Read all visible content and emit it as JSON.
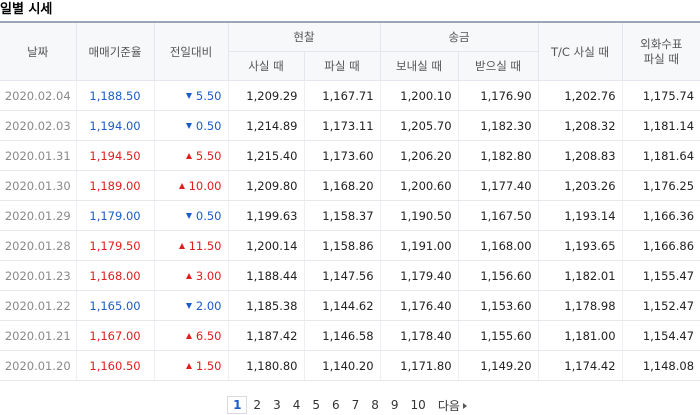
{
  "section_title": "일별 시세",
  "headers": {
    "date": "날짜",
    "base_rate": "매매기준율",
    "change": "전일대비",
    "cash": "현찰",
    "cash_buy": "사실 때",
    "cash_sell": "파실 때",
    "transfer": "송금",
    "transfer_send": "보내실 때",
    "transfer_receive": "받으실 때",
    "tc_buy": "T/C 사실 때",
    "foreign_check": "외화수표 파실 때"
  },
  "rows": [
    {
      "date": "2020.02.04",
      "base": "1,188.50",
      "dir": "down",
      "change": "5.50",
      "cash_buy": "1,209.29",
      "cash_sell": "1,167.71",
      "send": "1,200.10",
      "receive": "1,176.90",
      "tc": "1,202.76",
      "check": "1,175.74"
    },
    {
      "date": "2020.02.03",
      "base": "1,194.00",
      "dir": "down",
      "change": "0.50",
      "cash_buy": "1,214.89",
      "cash_sell": "1,173.11",
      "send": "1,205.70",
      "receive": "1,182.30",
      "tc": "1,208.32",
      "check": "1,181.14"
    },
    {
      "date": "2020.01.31",
      "base": "1,194.50",
      "dir": "up",
      "change": "5.50",
      "cash_buy": "1,215.40",
      "cash_sell": "1,173.60",
      "send": "1,206.20",
      "receive": "1,182.80",
      "tc": "1,208.83",
      "check": "1,181.64"
    },
    {
      "date": "2020.01.30",
      "base": "1,189.00",
      "dir": "up",
      "change": "10.00",
      "cash_buy": "1,209.80",
      "cash_sell": "1,168.20",
      "send": "1,200.60",
      "receive": "1,177.40",
      "tc": "1,203.26",
      "check": "1,176.25"
    },
    {
      "date": "2020.01.29",
      "base": "1,179.00",
      "dir": "down",
      "change": "0.50",
      "cash_buy": "1,199.63",
      "cash_sell": "1,158.37",
      "send": "1,190.50",
      "receive": "1,167.50",
      "tc": "1,193.14",
      "check": "1,166.36"
    },
    {
      "date": "2020.01.28",
      "base": "1,179.50",
      "dir": "up",
      "change": "11.50",
      "cash_buy": "1,200.14",
      "cash_sell": "1,158.86",
      "send": "1,191.00",
      "receive": "1,168.00",
      "tc": "1,193.65",
      "check": "1,166.86"
    },
    {
      "date": "2020.01.23",
      "base": "1,168.00",
      "dir": "up",
      "change": "3.00",
      "cash_buy": "1,188.44",
      "cash_sell": "1,147.56",
      "send": "1,179.40",
      "receive": "1,156.60",
      "tc": "1,182.01",
      "check": "1,155.47"
    },
    {
      "date": "2020.01.22",
      "base": "1,165.00",
      "dir": "down",
      "change": "2.00",
      "cash_buy": "1,185.38",
      "cash_sell": "1,144.62",
      "send": "1,176.40",
      "receive": "1,153.60",
      "tc": "1,178.98",
      "check": "1,152.47"
    },
    {
      "date": "2020.01.21",
      "base": "1,167.00",
      "dir": "up",
      "change": "6.50",
      "cash_buy": "1,187.42",
      "cash_sell": "1,146.58",
      "send": "1,178.40",
      "receive": "1,155.60",
      "tc": "1,181.00",
      "check": "1,154.47"
    },
    {
      "date": "2020.01.20",
      "base": "1,160.50",
      "dir": "up",
      "change": "1.50",
      "cash_buy": "1,180.80",
      "cash_sell": "1,140.20",
      "send": "1,171.80",
      "receive": "1,149.20",
      "tc": "1,174.42",
      "check": "1,148.08"
    }
  ],
  "pagination": {
    "pages": [
      "1",
      "2",
      "3",
      "4",
      "5",
      "6",
      "7",
      "8",
      "9",
      "10"
    ],
    "current": "1",
    "next_label": "다음"
  },
  "colors": {
    "up": "#e01e1e",
    "down": "#1c5cc8",
    "header_bg": "#f7f8fa",
    "header_border": "#9aa5b8"
  },
  "icons": {
    "up": "triangle-up-icon",
    "down": "triangle-down-icon",
    "next": "chevron-right-icon"
  }
}
